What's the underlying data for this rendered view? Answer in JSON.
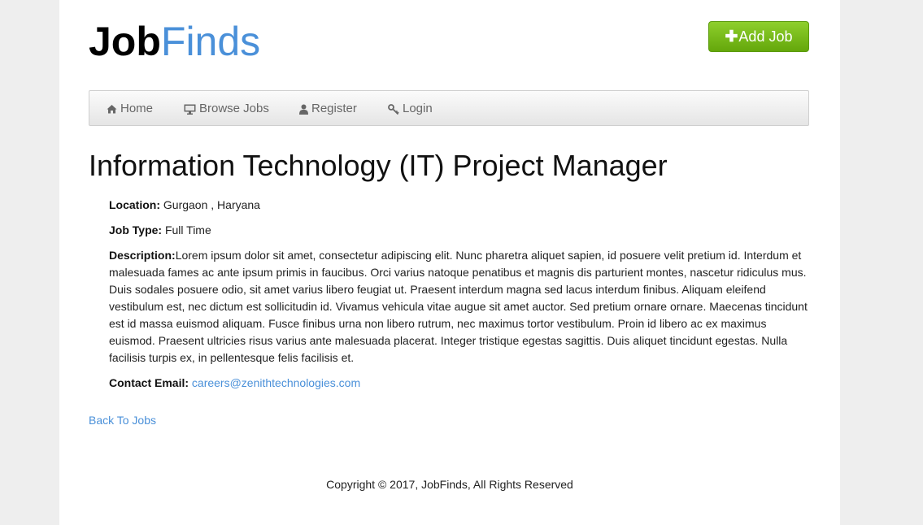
{
  "brand": {
    "part1": "Job",
    "part2": "Finds"
  },
  "header": {
    "add_button_icon": "plus-icon",
    "add_button_label": "Add Job"
  },
  "nav": {
    "home": "Home",
    "browse": "Browse Jobs",
    "register": "Register",
    "login": "Login"
  },
  "job": {
    "title": "Information Technology (IT) Project Manager",
    "location_label": "Location:",
    "location": "Gurgaon , Haryana",
    "type_label": "Job Type:",
    "type": "Full Time",
    "description_label": "Description:",
    "description": "Lorem ipsum dolor sit amet, consectetur adipiscing elit. Nunc pharetra aliquet sapien, id posuere velit pretium id. Interdum et malesuada fames ac ante ipsum primis in faucibus. Orci varius natoque penatibus et magnis dis parturient montes, nascetur ridiculus mus. Duis sodales posuere odio, sit amet varius libero feugiat ut. Praesent interdum magna sed lacus interdum finibus. Aliquam eleifend vestibulum est, nec dictum est sollicitudin id. Vivamus vehicula vitae augue sit amet auctor. Sed pretium ornare ornare. Maecenas tincidunt est id massa euismod aliquam. Fusce finibus urna non libero rutrum, nec maximus tortor vestibulum. Proin id libero ac ex maximus euismod. Praesent ultricies risus varius ante malesuada placerat. Integer tristique egestas sagittis. Duis aliquet tincidunt egestas. Nulla facilisis turpis ex, in pellentesque felis facilisis et.",
    "email_label": "Contact Email:",
    "email": "careers@zenithtechnologies.com"
  },
  "back_link": "Back To Jobs",
  "footer": {
    "copyright": "Copyright © 2017, JobFinds, All Rights Reserved"
  },
  "colors": {
    "brand_blue": "#4a90d9",
    "button_green": "#72b513",
    "page_bg": "#eeeeee"
  }
}
